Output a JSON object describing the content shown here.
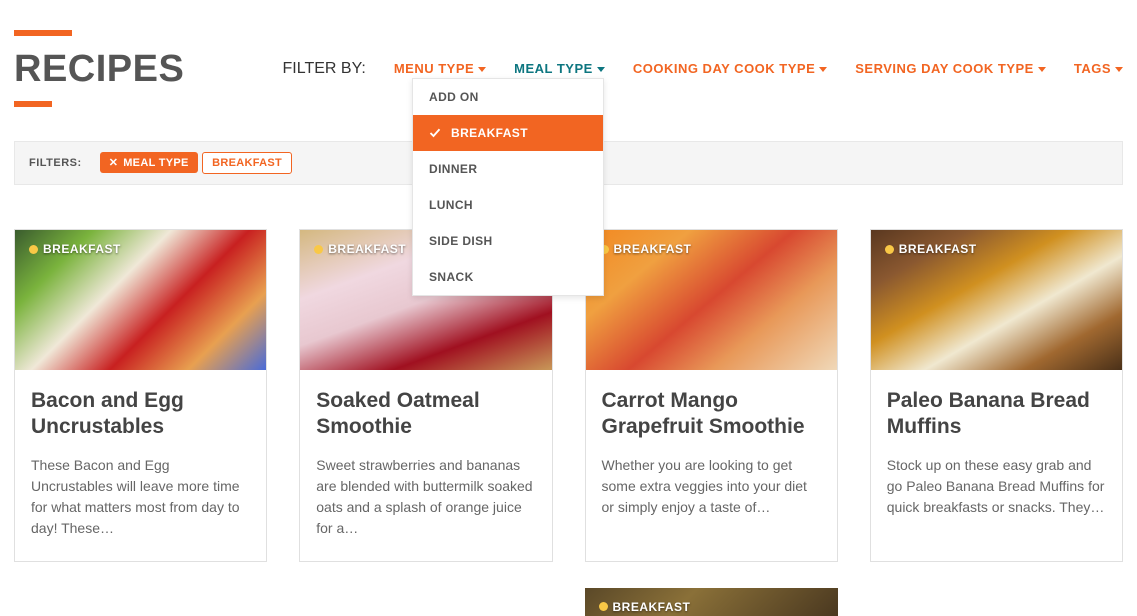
{
  "page_title": "RECIPES",
  "filter_by_label": "FILTER BY:",
  "filters": [
    {
      "label": "MENU TYPE",
      "style": "orange"
    },
    {
      "label": "MEAL TYPE",
      "style": "teal"
    },
    {
      "label": "COOKING DAY COOK TYPE",
      "style": "orange"
    },
    {
      "label": "SERVING DAY COOK TYPE",
      "style": "orange"
    },
    {
      "label": "TAGS",
      "style": "orange"
    }
  ],
  "dropdown": {
    "items": [
      {
        "label": "ADD ON",
        "active": false
      },
      {
        "label": "BREAKFAST",
        "active": true
      },
      {
        "label": "DINNER",
        "active": false
      },
      {
        "label": "LUNCH",
        "active": false
      },
      {
        "label": "SIDE DISH",
        "active": false
      },
      {
        "label": "SNACK",
        "active": false
      }
    ]
  },
  "active_filters": {
    "label": "FILTERS:",
    "tags": [
      {
        "label": "MEAL TYPE",
        "has_close": true,
        "style": "solid"
      },
      {
        "label": "BREAKFAST",
        "has_close": false,
        "style": "outline"
      }
    ]
  },
  "cards": [
    {
      "badge": "BREAKFAST",
      "title": "Bacon and Egg Uncrustables",
      "desc": "These Bacon and Egg Uncrustables will leave more time for what matters most from day to day! These…"
    },
    {
      "badge": "BREAKFAST",
      "title": "Soaked Oatmeal Smoothie",
      "desc": "Sweet strawberries and bananas are blended with buttermilk soaked oats and a splash of orange juice for a…"
    },
    {
      "badge": "BREAKFAST",
      "title": "Carrot Mango Grapefruit Smoothie",
      "desc": "Whether you are looking to get some extra veggies into your diet or simply enjoy a taste of…"
    },
    {
      "badge": "BREAKFAST",
      "title": "Paleo Banana Bread Muffins",
      "desc": "Stock up on these easy grab and go Paleo Banana Bread Muffins for quick breakfasts or snacks. They…"
    }
  ],
  "partial_card": {
    "badge": "BREAKFAST"
  }
}
